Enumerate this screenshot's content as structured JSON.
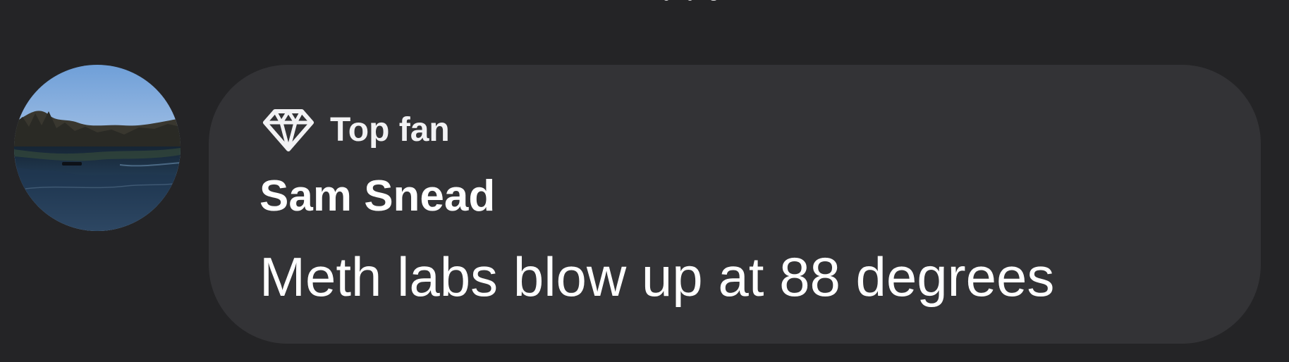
{
  "comment": {
    "badge": {
      "icon": "diamond-icon",
      "label": "Top fan"
    },
    "author": "Sam Snead",
    "text": "Meth labs blow up at 88 degrees",
    "avatar": {
      "description": "lake landscape"
    }
  },
  "theme": {
    "background": "#242426",
    "bubble": "#333336",
    "text": "#ffffff"
  }
}
